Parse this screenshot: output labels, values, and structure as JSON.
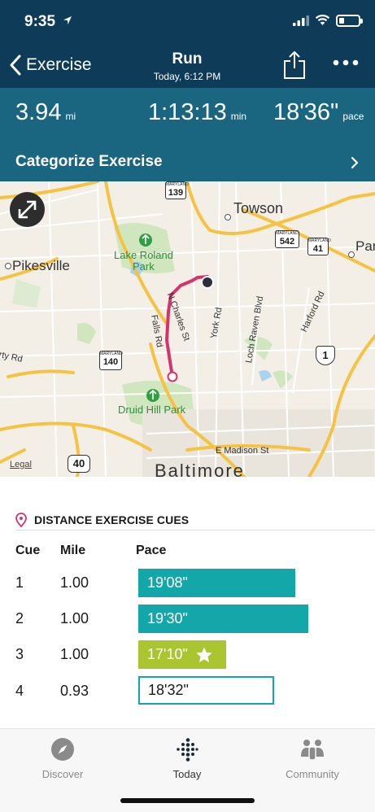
{
  "status_bar": {
    "time": "9:35"
  },
  "header": {
    "back_label": "Exercise",
    "title": "Run",
    "subtitle": "Today, 6:12 PM"
  },
  "summary": {
    "distance": {
      "value": "3.94",
      "unit": "mi"
    },
    "duration": {
      "value": "1:13:13",
      "unit": "min"
    },
    "pace": {
      "value": "18'36\"",
      "unit": "pace"
    },
    "categorize_label": "Categorize Exercise"
  },
  "map": {
    "labels": {
      "towson": "Towson",
      "pikesville": "Pikesville",
      "baltimore": "Baltimore",
      "lake_roland_1": "Lake Roland",
      "lake_roland_2": "Park",
      "druid_hill": "Druid Hill Park",
      "n_charles": "N Charles St",
      "falls_rd": "Falls Rd",
      "york_rd": "York Rd",
      "loch_raven": "Loch Raven Blvd",
      "harford_rd": "Harford Rd",
      "e_madison": "E Madison St",
      "rty_rd": "rty Rd",
      "par": "Par"
    },
    "route_shields": {
      "md139": "139",
      "md542": "542",
      "md41": "41",
      "md140": "140",
      "us1": "1",
      "i40": "40",
      "maryland": "MARYLAND"
    },
    "legal_label": "Legal",
    "colors": {
      "route": "#d6336c",
      "highway": "#f5c242",
      "park": "#cfe6bf",
      "water": "#a9d2f0"
    }
  },
  "cues": {
    "title": "DISTANCE EXERCISE CUES",
    "columns": {
      "cue": "Cue",
      "mile": "Mile",
      "pace": "Pace"
    },
    "rows": [
      {
        "cue": "1",
        "mile": "1.00",
        "pace": "19'08\"",
        "style": "teal",
        "bar_fraction": 0.78
      },
      {
        "cue": "2",
        "mile": "1.00",
        "pace": "19'30\"",
        "style": "teal",
        "bar_fraction": 0.82
      },
      {
        "cue": "3",
        "mile": "1.00",
        "pace": "17'10\"",
        "style": "lime",
        "best": true,
        "bar_fraction": 0.45
      },
      {
        "cue": "4",
        "mile": "0.93",
        "pace": "18'32\"",
        "style": "outline",
        "bar_fraction": 0.72
      }
    ]
  },
  "tabs": [
    {
      "label": "Discover",
      "icon": "compass-icon",
      "active": false
    },
    {
      "label": "Today",
      "icon": "fitbit-dots-icon",
      "active": true
    },
    {
      "label": "Community",
      "icon": "community-icon",
      "active": false
    }
  ],
  "colors": {
    "header_bg": "#0e3b58",
    "summary_bg": "#1a6580",
    "teal": "#14a7a9",
    "lime": "#a9c52f",
    "cue_pin": "#d6336c"
  }
}
